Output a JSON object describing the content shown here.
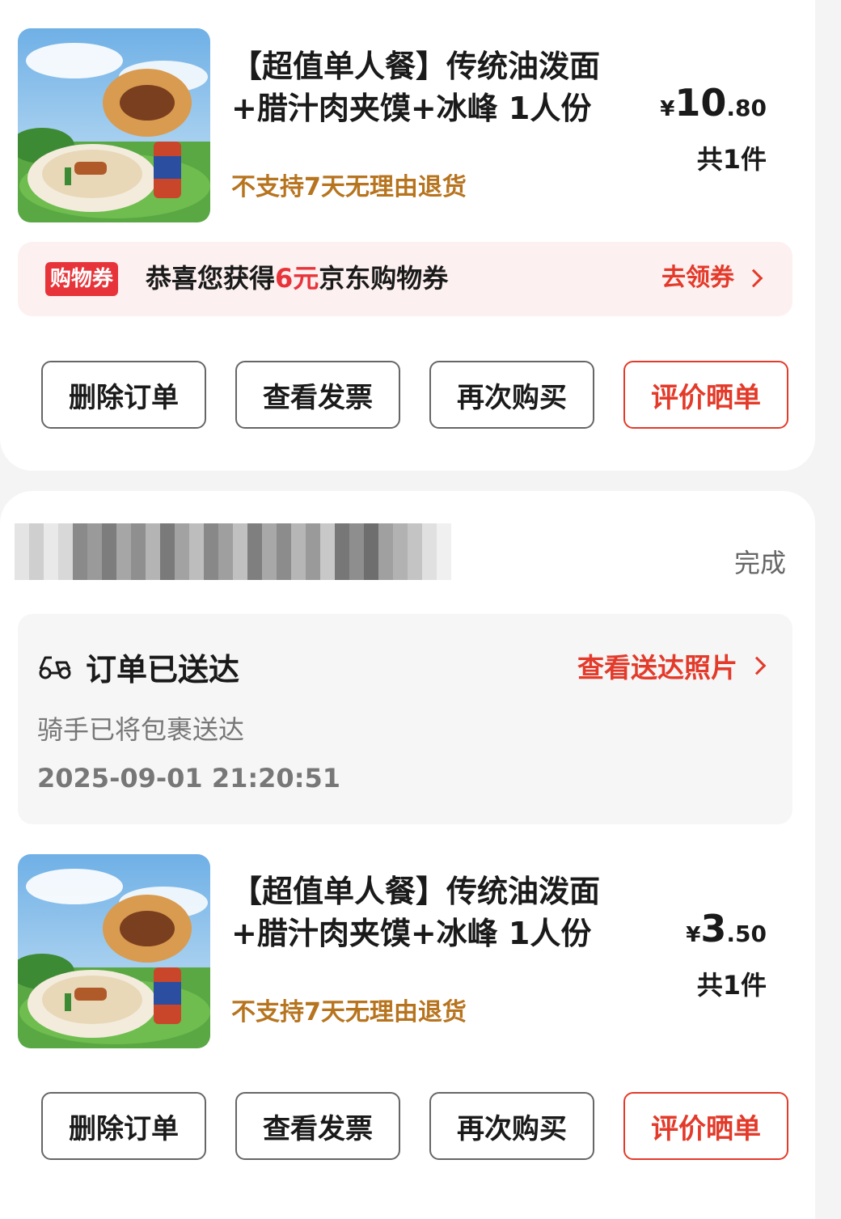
{
  "orders": [
    {
      "product": {
        "title_line1": "【超值单人餐】传统油泼面",
        "title_line2": "+腊汁肉夹馍+冰峰 1人份",
        "image_name": "food-thumbnail",
        "no_return": "不支持7天无理由退货",
        "price_currency": "¥",
        "price_int": "10",
        "price_dec": ".80",
        "qty": "共1件"
      },
      "coupon": {
        "badge": "购物券",
        "text_before": "恭喜您获得",
        "highlight": "6元",
        "text_after": "京东购物券",
        "link": "去领券"
      },
      "buttons": [
        "删除订单",
        "查看发票",
        "再次购买",
        "评价晒单"
      ]
    },
    {
      "status": "完成",
      "delivery": {
        "title": "订单已送达",
        "link": "查看送达照片",
        "subtitle": "骑手已将包裹送达",
        "time": "2025-09-01 21:20:51"
      },
      "product": {
        "title_line1": "【超值单人餐】传统油泼面",
        "title_line2": "+腊汁肉夹馍+冰峰 1人份",
        "image_name": "food-thumbnail",
        "no_return": "不支持7天无理由退货",
        "price_currency": "¥",
        "price_int": "3",
        "price_dec": ".50",
        "qty": "共1件"
      },
      "buttons": [
        "删除订单",
        "查看发票",
        "再次购买",
        "评价晒单"
      ]
    }
  ],
  "colors": {
    "accent": "#e33a2a",
    "warning": "#b7741f",
    "coupon_bg": "#fdf0f0"
  }
}
